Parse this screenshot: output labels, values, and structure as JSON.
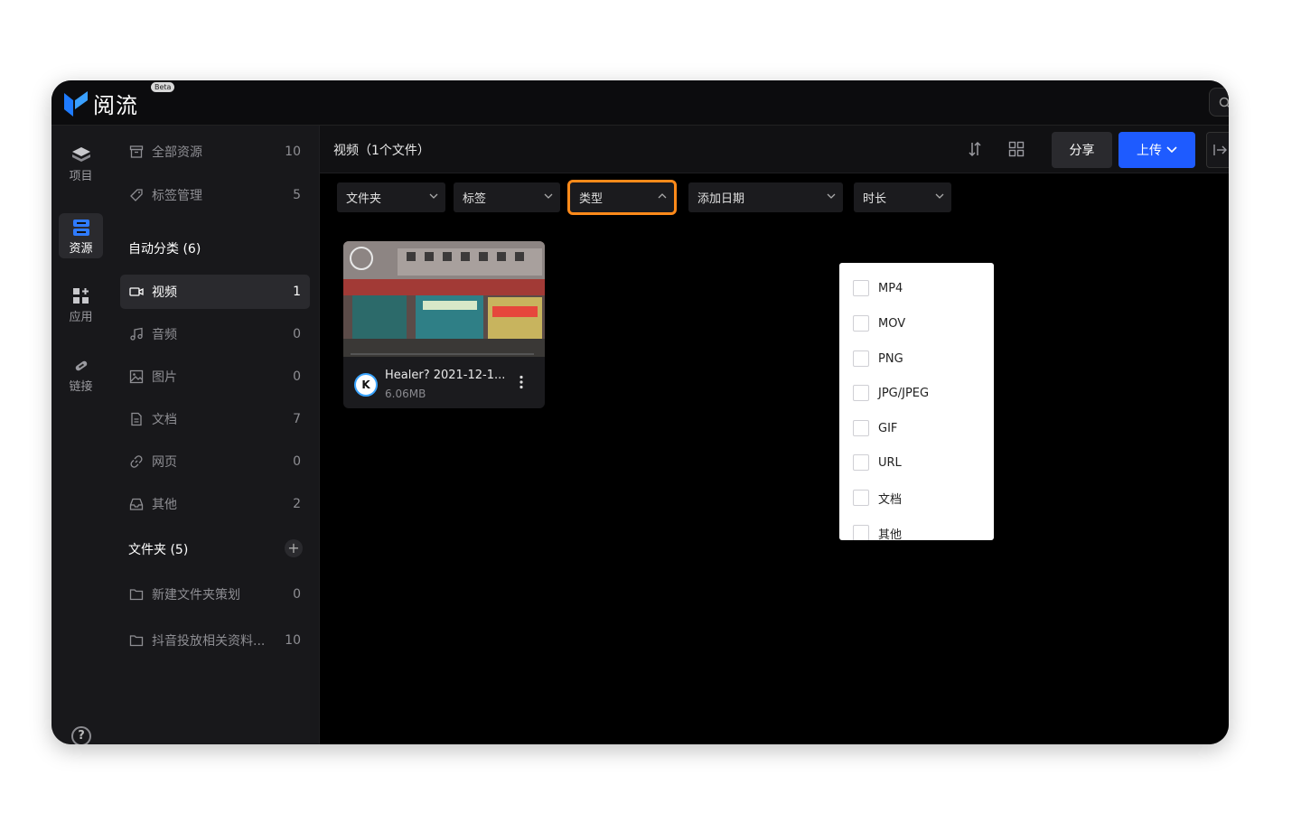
{
  "app": {
    "name": "阅流",
    "badge": "Beta"
  },
  "rail": [
    {
      "label": "项目",
      "icon": "layers-icon"
    },
    {
      "label": "资源",
      "icon": "database-icon"
    },
    {
      "label": "应用",
      "icon": "apps-icon"
    },
    {
      "label": "链接",
      "icon": "link-tool-icon"
    }
  ],
  "help": "?",
  "sidebar": {
    "all": {
      "label": "全部资源",
      "count": "10"
    },
    "tags": {
      "label": "标签管理",
      "count": "5"
    },
    "auto_heading": "自动分类 (6)",
    "categories": [
      {
        "label": "视频",
        "count": "1"
      },
      {
        "label": "音频",
        "count": "0"
      },
      {
        "label": "图片",
        "count": "0"
      },
      {
        "label": "文档",
        "count": "7"
      },
      {
        "label": "网页",
        "count": "0"
      },
      {
        "label": "其他",
        "count": "2"
      }
    ],
    "folder_heading": "文件夹 (5)",
    "folder_add": "+",
    "folders": [
      {
        "label": "新建文件夹策划",
        "count": "0"
      },
      {
        "label": "抖音投放相关资料...",
        "count": "10"
      }
    ]
  },
  "main": {
    "title": "视频（1个文件）",
    "share_label": "分享",
    "upload_label": "上传"
  },
  "filters": [
    {
      "label": "文件夹"
    },
    {
      "label": "标签"
    },
    {
      "label": "类型"
    },
    {
      "label": "添加日期"
    },
    {
      "label": "时长"
    }
  ],
  "type_options": [
    "MP4",
    "MOV",
    "PNG",
    "JPG/JPEG",
    "GIF",
    "URL",
    "文档",
    "其他"
  ],
  "card": {
    "name": "Healer? 2021-12-1...",
    "size": "6.06MB",
    "avatar": "K"
  },
  "colors": {
    "accent": "#1e5bff",
    "highlight": "#ff8a1a",
    "background": "#000000"
  }
}
